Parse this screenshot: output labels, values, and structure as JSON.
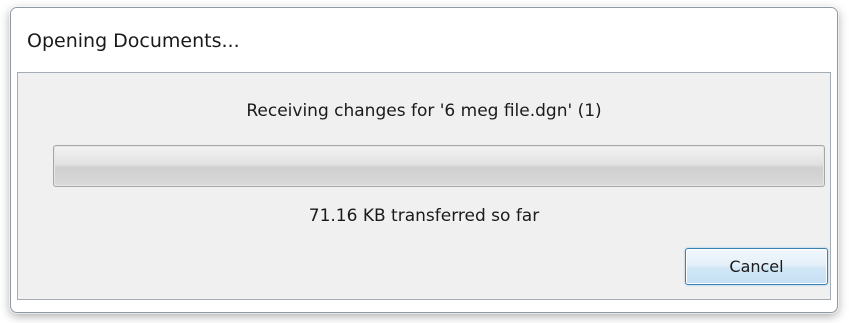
{
  "dialog": {
    "title": "Opening Documents...",
    "status_message": "Receiving changes for '6 meg file.dgn' (1)",
    "progress_fraction": 0,
    "transferred_message": "71.16 KB transferred so far",
    "cancel_label": "Cancel"
  }
}
